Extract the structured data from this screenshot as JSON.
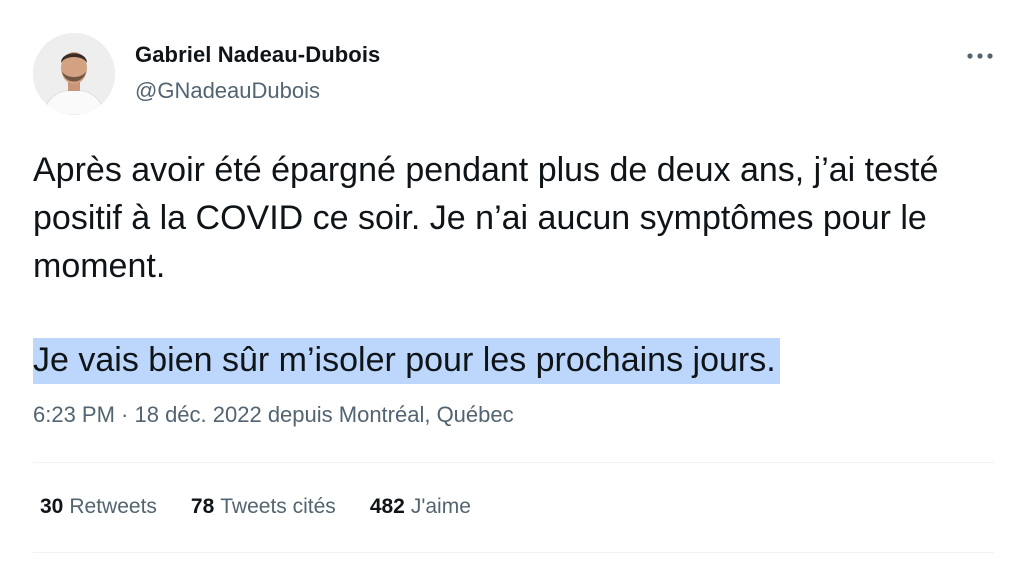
{
  "author": {
    "name": "Gabriel Nadeau-Dubois",
    "handle": "@GNadeauDubois"
  },
  "tweet": {
    "paragraph_1": "Après avoir été épargné pendant plus de deux ans, j’ai testé positif à la COVID ce soir. Je n’ai aucun symptômes pour le moment.",
    "paragraph_2": "Je vais bien sûr m’isoler pour les prochains jours.",
    "timestamp": "6:23 PM · 18 déc. 2022 depuis Montréal, Québec"
  },
  "stats": [
    {
      "count": "30",
      "label": "Retweets"
    },
    {
      "count": "78",
      "label": "Tweets cités"
    },
    {
      "count": "482",
      "label": "J'aime"
    }
  ],
  "icons": {
    "more": "more-horizontal-icon"
  },
  "colors": {
    "text": "#0f1419",
    "secondary": "#536471",
    "highlight": "#bcd7fb",
    "divider": "#eff3f4"
  }
}
